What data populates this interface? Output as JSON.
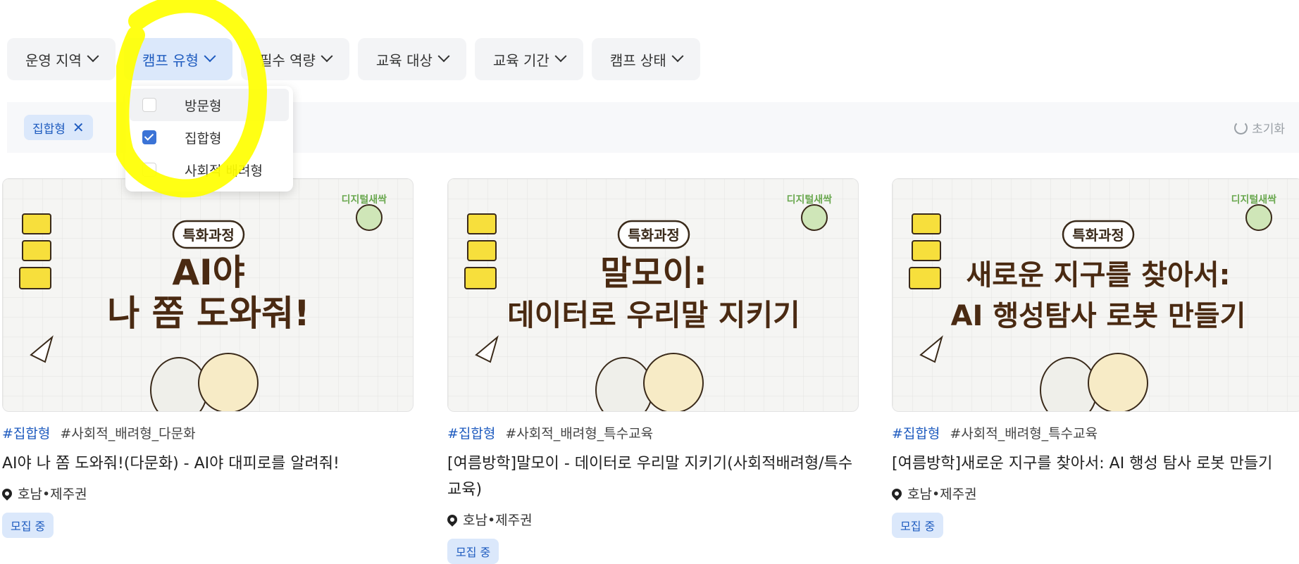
{
  "filters": [
    {
      "label": "운영 지역"
    },
    {
      "label": "캠프 유형"
    },
    {
      "label": "필수 역량"
    },
    {
      "label": "교육 대상"
    },
    {
      "label": "교육 기간"
    },
    {
      "label": "캠프 상태"
    }
  ],
  "dropdown": {
    "options": [
      {
        "label": "방문형",
        "checked": false
      },
      {
        "label": "집합형",
        "checked": true
      },
      {
        "label": "사회적 배려형",
        "checked": false
      }
    ]
  },
  "applied": {
    "tag": "집합형",
    "remove": "✕",
    "reset": "초기화"
  },
  "cards": [
    {
      "badge": "특화과정",
      "brand": "디지털새싹",
      "headline1": "AI야",
      "headline2": "나 쫌 도와줘!",
      "tag1": "#집합형",
      "tag2": "#사회적_배려형_다문화",
      "title": "AI야 나 쫌 도와줘!(다문화) - AI야 대피로를 알려줘!",
      "location": "호남•제주권",
      "status": "모집 중"
    },
    {
      "badge": "특화과정",
      "brand": "디지털새싹",
      "headline1": "말모이:",
      "headline2": "데이터로 우리말 지키기",
      "tag1": "#집합형",
      "tag2": "#사회적_배려형_특수교육",
      "title": "[여름방학]말모이 - 데이터로 우리말 지키기(사회적배려형/특수교육)",
      "location": "호남•제주권",
      "status": "모집 중"
    },
    {
      "badge": "특화과정",
      "brand": "디지털새싹",
      "headline1": "새로운 지구를 찾아서:",
      "headline2": "AI 행성탐사 로봇 만들기",
      "tag1": "#집합형",
      "tag2": "#사회적_배려형_특수교육",
      "title": "[여름방학]새로운 지구를 찾아서: AI 행성 탐사 로봇 만들기",
      "location": "호남•제주권",
      "status": "모집 중"
    }
  ],
  "icons": {
    "chevron": "chevron-down-icon",
    "pin": "location-pin-icon",
    "reset": "refresh-icon",
    "check": "check-icon"
  },
  "colors": {
    "accent": "#1e5bbf",
    "accent_bg": "#dbe8fb",
    "highlight": "#ffff00",
    "headline": "#4a2a12"
  }
}
